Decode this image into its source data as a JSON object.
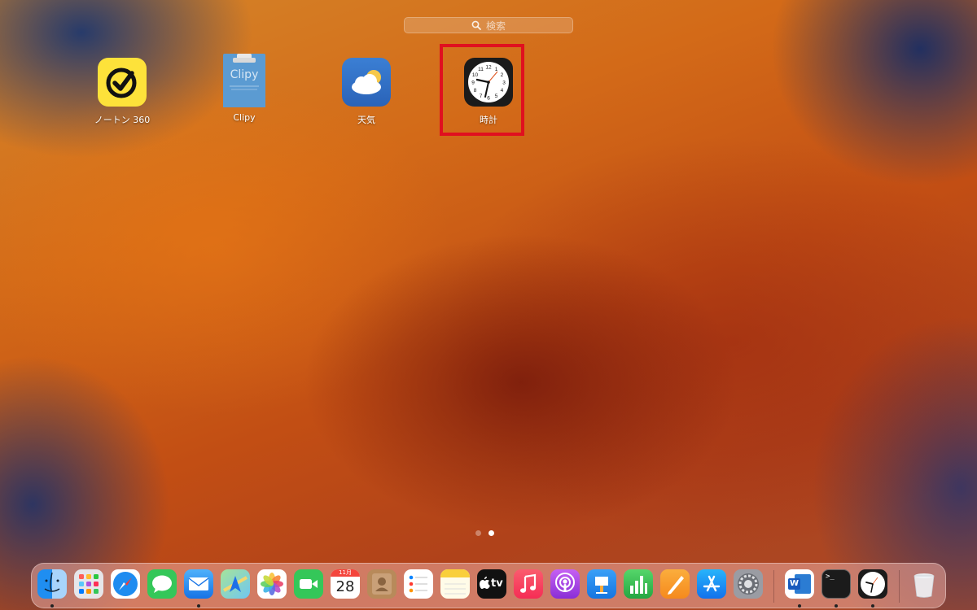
{
  "search": {
    "placeholder": "検索"
  },
  "apps": [
    {
      "name": "norton",
      "label": "ノートン 360"
    },
    {
      "name": "clipy",
      "label": "Clipy",
      "tile_text": "Clipy"
    },
    {
      "name": "weather",
      "label": "天気"
    },
    {
      "name": "clock",
      "label": "時計",
      "highlighted": true
    }
  ],
  "clock_numbers": [
    "12",
    "1",
    "2",
    "3",
    "4",
    "5",
    "6",
    "7",
    "8",
    "9",
    "10",
    "11"
  ],
  "pagination": {
    "pages": 2,
    "current": 2
  },
  "dock": {
    "calendar": {
      "month": "11月",
      "day": "28"
    },
    "tv_label": "tv",
    "word_letter": "W",
    "terminal_prompt": ">_"
  },
  "colors": {
    "highlight": "#e0101f",
    "norton_yellow": "#fde23a",
    "clipy_blue": "#5b9bd2"
  }
}
